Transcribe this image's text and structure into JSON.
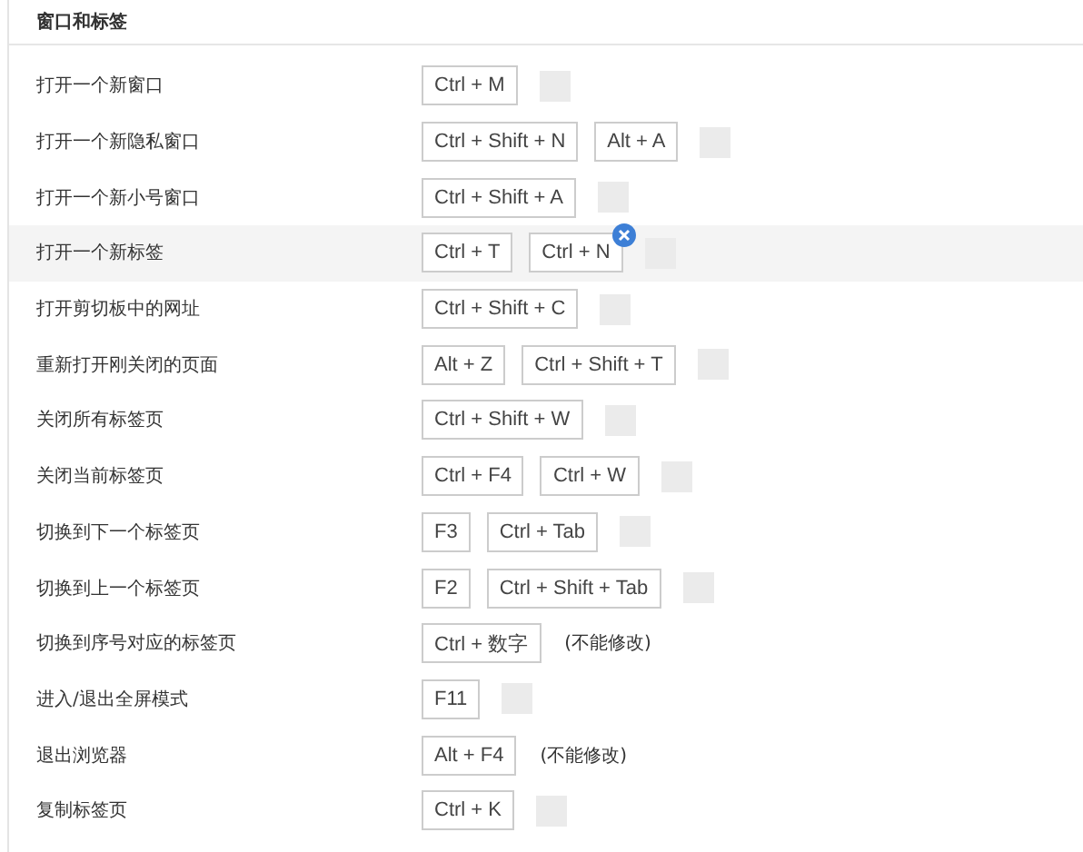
{
  "section_title": "窗口和标签",
  "rows": [
    {
      "label": "打开一个新窗口",
      "hovered": false,
      "keys": [
        {
          "text": "Ctrl + M",
          "removable": false
        }
      ],
      "add_button": true
    },
    {
      "label": "打开一个新隐私窗口",
      "hovered": false,
      "keys": [
        {
          "text": "Ctrl + Shift + N",
          "removable": false
        },
        {
          "text": "Alt + A",
          "removable": false
        }
      ],
      "add_button": true
    },
    {
      "label": "打开一个新小号窗口",
      "hovered": false,
      "keys": [
        {
          "text": "Ctrl + Shift + A",
          "removable": false
        }
      ],
      "add_button": true
    },
    {
      "label": "打开一个新标签",
      "hovered": true,
      "keys": [
        {
          "text": "Ctrl + T",
          "removable": false
        },
        {
          "text": "Ctrl + N",
          "removable": true
        }
      ],
      "add_button": true
    },
    {
      "label": "打开剪切板中的网址",
      "hovered": false,
      "keys": [
        {
          "text": "Ctrl + Shift + C",
          "removable": false
        }
      ],
      "add_button": true
    },
    {
      "label": "重新打开刚关闭的页面",
      "hovered": false,
      "keys": [
        {
          "text": "Alt + Z",
          "removable": false
        },
        {
          "text": "Ctrl + Shift + T",
          "removable": false
        }
      ],
      "add_button": true
    },
    {
      "label": "关闭所有标签页",
      "hovered": false,
      "keys": [
        {
          "text": "Ctrl + Shift + W",
          "removable": false
        }
      ],
      "add_button": true
    },
    {
      "label": "关闭当前标签页",
      "hovered": false,
      "keys": [
        {
          "text": "Ctrl + F4",
          "removable": false
        },
        {
          "text": "Ctrl + W",
          "removable": false
        }
      ],
      "add_button": true
    },
    {
      "label": "切换到下一个标签页",
      "hovered": false,
      "keys": [
        {
          "text": "F3",
          "removable": false
        },
        {
          "text": "Ctrl + Tab",
          "removable": false
        }
      ],
      "add_button": true
    },
    {
      "label": "切换到上一个标签页",
      "hovered": false,
      "keys": [
        {
          "text": "F2",
          "removable": false
        },
        {
          "text": "Ctrl + Shift + Tab",
          "removable": false
        }
      ],
      "add_button": true
    },
    {
      "label": "切换到序号对应的标签页",
      "hovered": false,
      "keys": [
        {
          "text": "Ctrl + 数字",
          "removable": false
        }
      ],
      "add_button": false,
      "note": "(不能修改)"
    },
    {
      "label": "进入/退出全屏模式",
      "hovered": false,
      "keys": [
        {
          "text": "F11",
          "removable": false
        }
      ],
      "add_button": true
    },
    {
      "label": "退出浏览器",
      "hovered": false,
      "keys": [
        {
          "text": "Alt + F4",
          "removable": false
        }
      ],
      "add_button": false,
      "note": "(不能修改)"
    },
    {
      "label": "复制标签页",
      "hovered": false,
      "keys": [
        {
          "text": "Ctrl + K",
          "removable": false
        }
      ],
      "add_button": true
    }
  ]
}
